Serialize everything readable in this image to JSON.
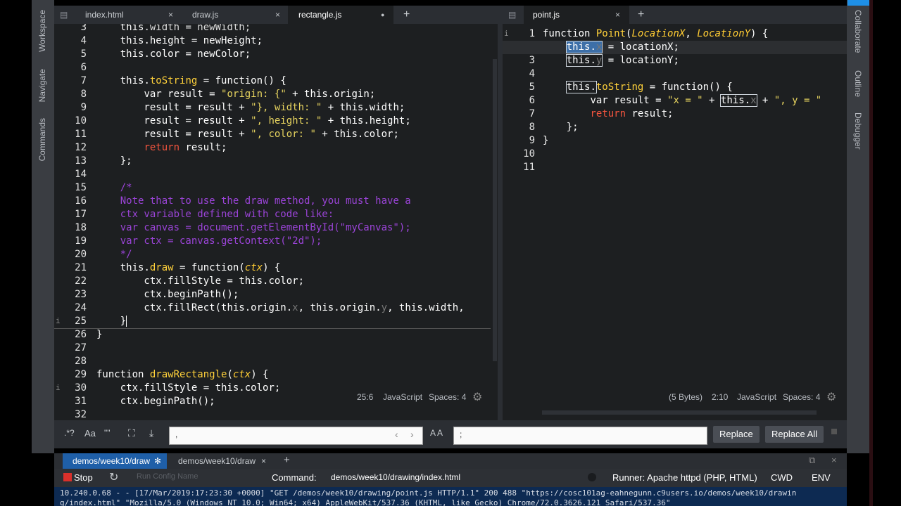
{
  "left_sidebar": [
    "Workspace",
    "Navigate",
    "Commands"
  ],
  "right_sidebar": [
    "Collaborate",
    "Outline",
    "Debugger"
  ],
  "left_tabs": [
    {
      "label": "index.html",
      "close": "×"
    },
    {
      "label": "draw.js",
      "close": "×"
    },
    {
      "label": "rectangle.js",
      "close": "●"
    }
  ],
  "right_tabs": [
    {
      "label": "point.js",
      "close": "×"
    }
  ],
  "add_tab": "+",
  "left_editor": {
    "line_numbers": [
      "3",
      "4",
      "5",
      "6",
      "7",
      "8",
      "9",
      "10",
      "11",
      "12",
      "13",
      "14",
      "15",
      "16",
      "17",
      "18",
      "19",
      "20",
      "21",
      "22",
      "23",
      "24",
      "25",
      "26",
      "27",
      "28",
      "29",
      "30",
      "31",
      "32"
    ],
    "status": {
      "cursor": "25:6",
      "language": "JavaScript",
      "spaces": "Spaces: 4"
    }
  },
  "right_editor": {
    "line_numbers": [
      "1",
      "2",
      "3",
      "4",
      "5",
      "6",
      "7",
      "8",
      "9",
      "10",
      "11"
    ],
    "status": {
      "bytes": "(5 Bytes)",
      "cursor": "2:10",
      "language": "JavaScript",
      "spaces": "Spaces: 4"
    }
  },
  "find_bar": {
    "regex": ".*?",
    "case": "Aa",
    "word": "\"\"",
    "find_value": ",",
    "aa_label": "A A",
    "replace_value": ";",
    "replace_btn": "Replace",
    "replace_all_btn": "Replace All"
  },
  "terminal_tabs": [
    {
      "label": "demos/week10/draw"
    },
    {
      "label": "demos/week10/draw",
      "close": "×"
    }
  ],
  "command_bar": {
    "stop": "Stop",
    "run_config_placeholder": "Run Config Name",
    "command_label": "Command:",
    "command_value": "demos/week10/drawing/index.html",
    "runner": "Runner: Apache httpd (PHP, HTML)",
    "cwd": "CWD",
    "env": "ENV"
  },
  "log_lines": [
    "10.240.0.68 - - [17/Mar/2019:17:23:30 +0000] \"GET /demos/week10/drawing/point.js HTTP/1.1\" 200 488 \"https://cosc101ag-eahnegunn.c9users.io/demos/week10/drawin",
    "g/index.html\" \"Mozilla/5.0 (Windows NT 10.0; Win64; x64) AppleWebKit/537.36 (KHTML, like Gecko) Chrome/72.0.3626.121 Safari/537.36\""
  ],
  "colors": {
    "accent": "#1e8fe6",
    "editor_bg": "#1d1f21",
    "comment": "#9b44d8",
    "keyword_this": "#ffffff"
  }
}
